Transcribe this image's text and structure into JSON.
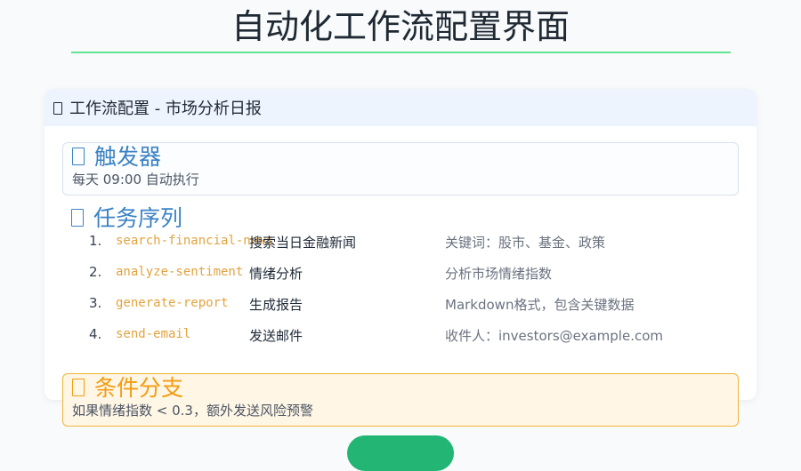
{
  "page": {
    "title": "自动化工作流配置界面"
  },
  "workflow": {
    "icon": "workflow-icon",
    "title": "工作流配置 - 市场分析日报"
  },
  "trigger": {
    "icon": "trigger-icon",
    "title": "触发器",
    "value": "每天 09:00 自动执行"
  },
  "tasks": {
    "icon": "task-list-icon",
    "title": "任务序列",
    "items": [
      {
        "num": "1.",
        "id": "search-financial-news",
        "name": "搜索当日金融新闻",
        "desc": "关键词：股市、基金、政策"
      },
      {
        "num": "2.",
        "id": "analyze-sentiment",
        "name": "情绪分析",
        "desc": "分析市场情绪指数"
      },
      {
        "num": "3.",
        "id": "generate-report",
        "name": "生成报告",
        "desc": "Markdown格式，包含关键数据"
      },
      {
        "num": "4.",
        "id": "send-email",
        "name": "发送邮件",
        "desc": "收件人：investors@example.com"
      }
    ]
  },
  "branch": {
    "icon": "branch-icon",
    "title": "条件分支",
    "value": "如果情绪指数 < 0.3，额外发送风险预警"
  },
  "colors": {
    "accent_blue": "#3b82c4",
    "accent_orange": "#f39c12",
    "accent_green": "#22b573"
  }
}
